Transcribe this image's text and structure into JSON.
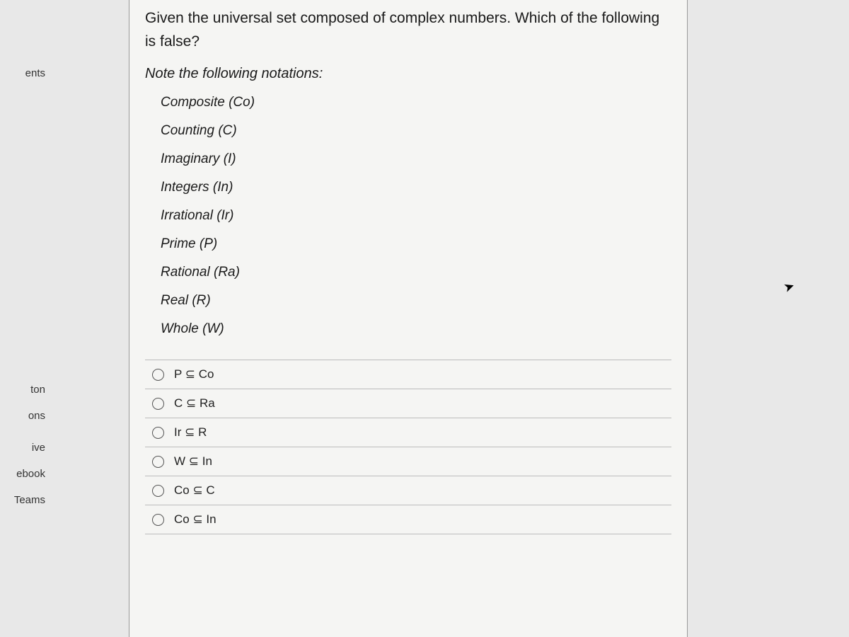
{
  "sidebar": {
    "items": [
      {
        "label": "ents"
      },
      {
        "label": "ton"
      },
      {
        "label": "ons"
      },
      {
        "label": "ive"
      },
      {
        "label": "ebook"
      },
      {
        "label": "Teams"
      }
    ]
  },
  "question": {
    "prompt": "Given the universal set composed of complex numbers. Which of the following is false?",
    "note": "Note the following notations:",
    "notations": [
      "Composite (Co)",
      "Counting (C)",
      "Imaginary (I)",
      "Integers (In)",
      "Irrational (Ir)",
      "Prime (P)",
      "Rational (Ra)",
      "Real (R)",
      "Whole (W)"
    ],
    "options": [
      "P ⊆ Co",
      "C ⊆ Ra",
      "Ir ⊆ R",
      "W ⊆ In",
      "Co ⊆ C",
      "Co ⊆ In"
    ]
  }
}
